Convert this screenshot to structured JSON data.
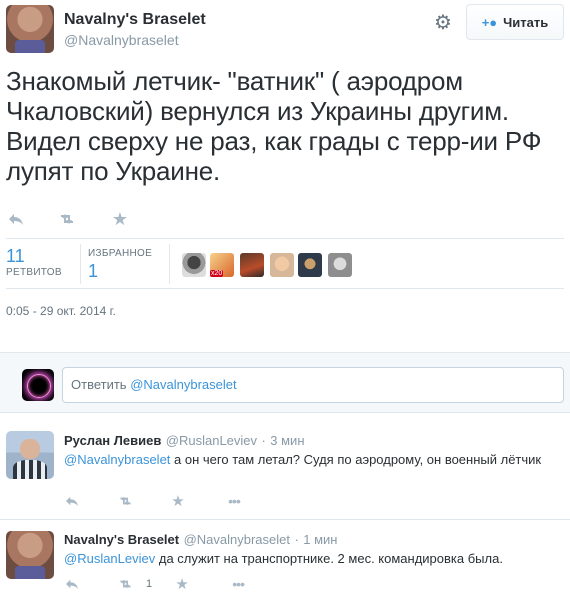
{
  "header": {
    "display_name": "Navalny's Braselet",
    "handle": "@Navalnybraselet",
    "follow_label": "Читать"
  },
  "tweet": {
    "text": "Знакомый летчик- \"ватник\" ( аэродром Чкаловский) вернулся из Украины другим. Видел сверху не раз, как грады с терр-ии РФ лупят по Украине.",
    "retweets_count": "11",
    "retweets_label": "РЕТВИТОВ",
    "favorites_label": "ИЗБРАННОЕ",
    "favorites_count": "1",
    "timestamp": "0:05 - 29 окт. 2014 г.",
    "favoriter_badge": "x20"
  },
  "reply_box": {
    "label": "Ответить",
    "mention": "@Navalnybraselet"
  },
  "replies": [
    {
      "name": "Руслан Левиев",
      "handle": "@RuslanLeviev",
      "sep": "·",
      "time": "3 мин",
      "mention": "@Navalnybraselet",
      "text": " а он чего там летал? Судя по аэродрому, он военный лётчик"
    },
    {
      "name": "Navalny's Braselet",
      "handle": "@Navalnybraselet",
      "sep": "·",
      "time": "1 мин",
      "mention": "@RuslanLeviev",
      "text": " да служит на транспортнике. 2 мес. командировка была.",
      "retweet_count": "1"
    }
  ],
  "icons": {
    "reply": "reply-icon",
    "retweet": "retweet-icon",
    "favorite": "star-icon",
    "more": "more-icon",
    "settings": "gear-icon",
    "follow": "add-user-icon"
  },
  "colors": {
    "link": "#3b94d9",
    "text": "#292f33",
    "muted": "#8899a6",
    "action": "#a9b9c6"
  }
}
